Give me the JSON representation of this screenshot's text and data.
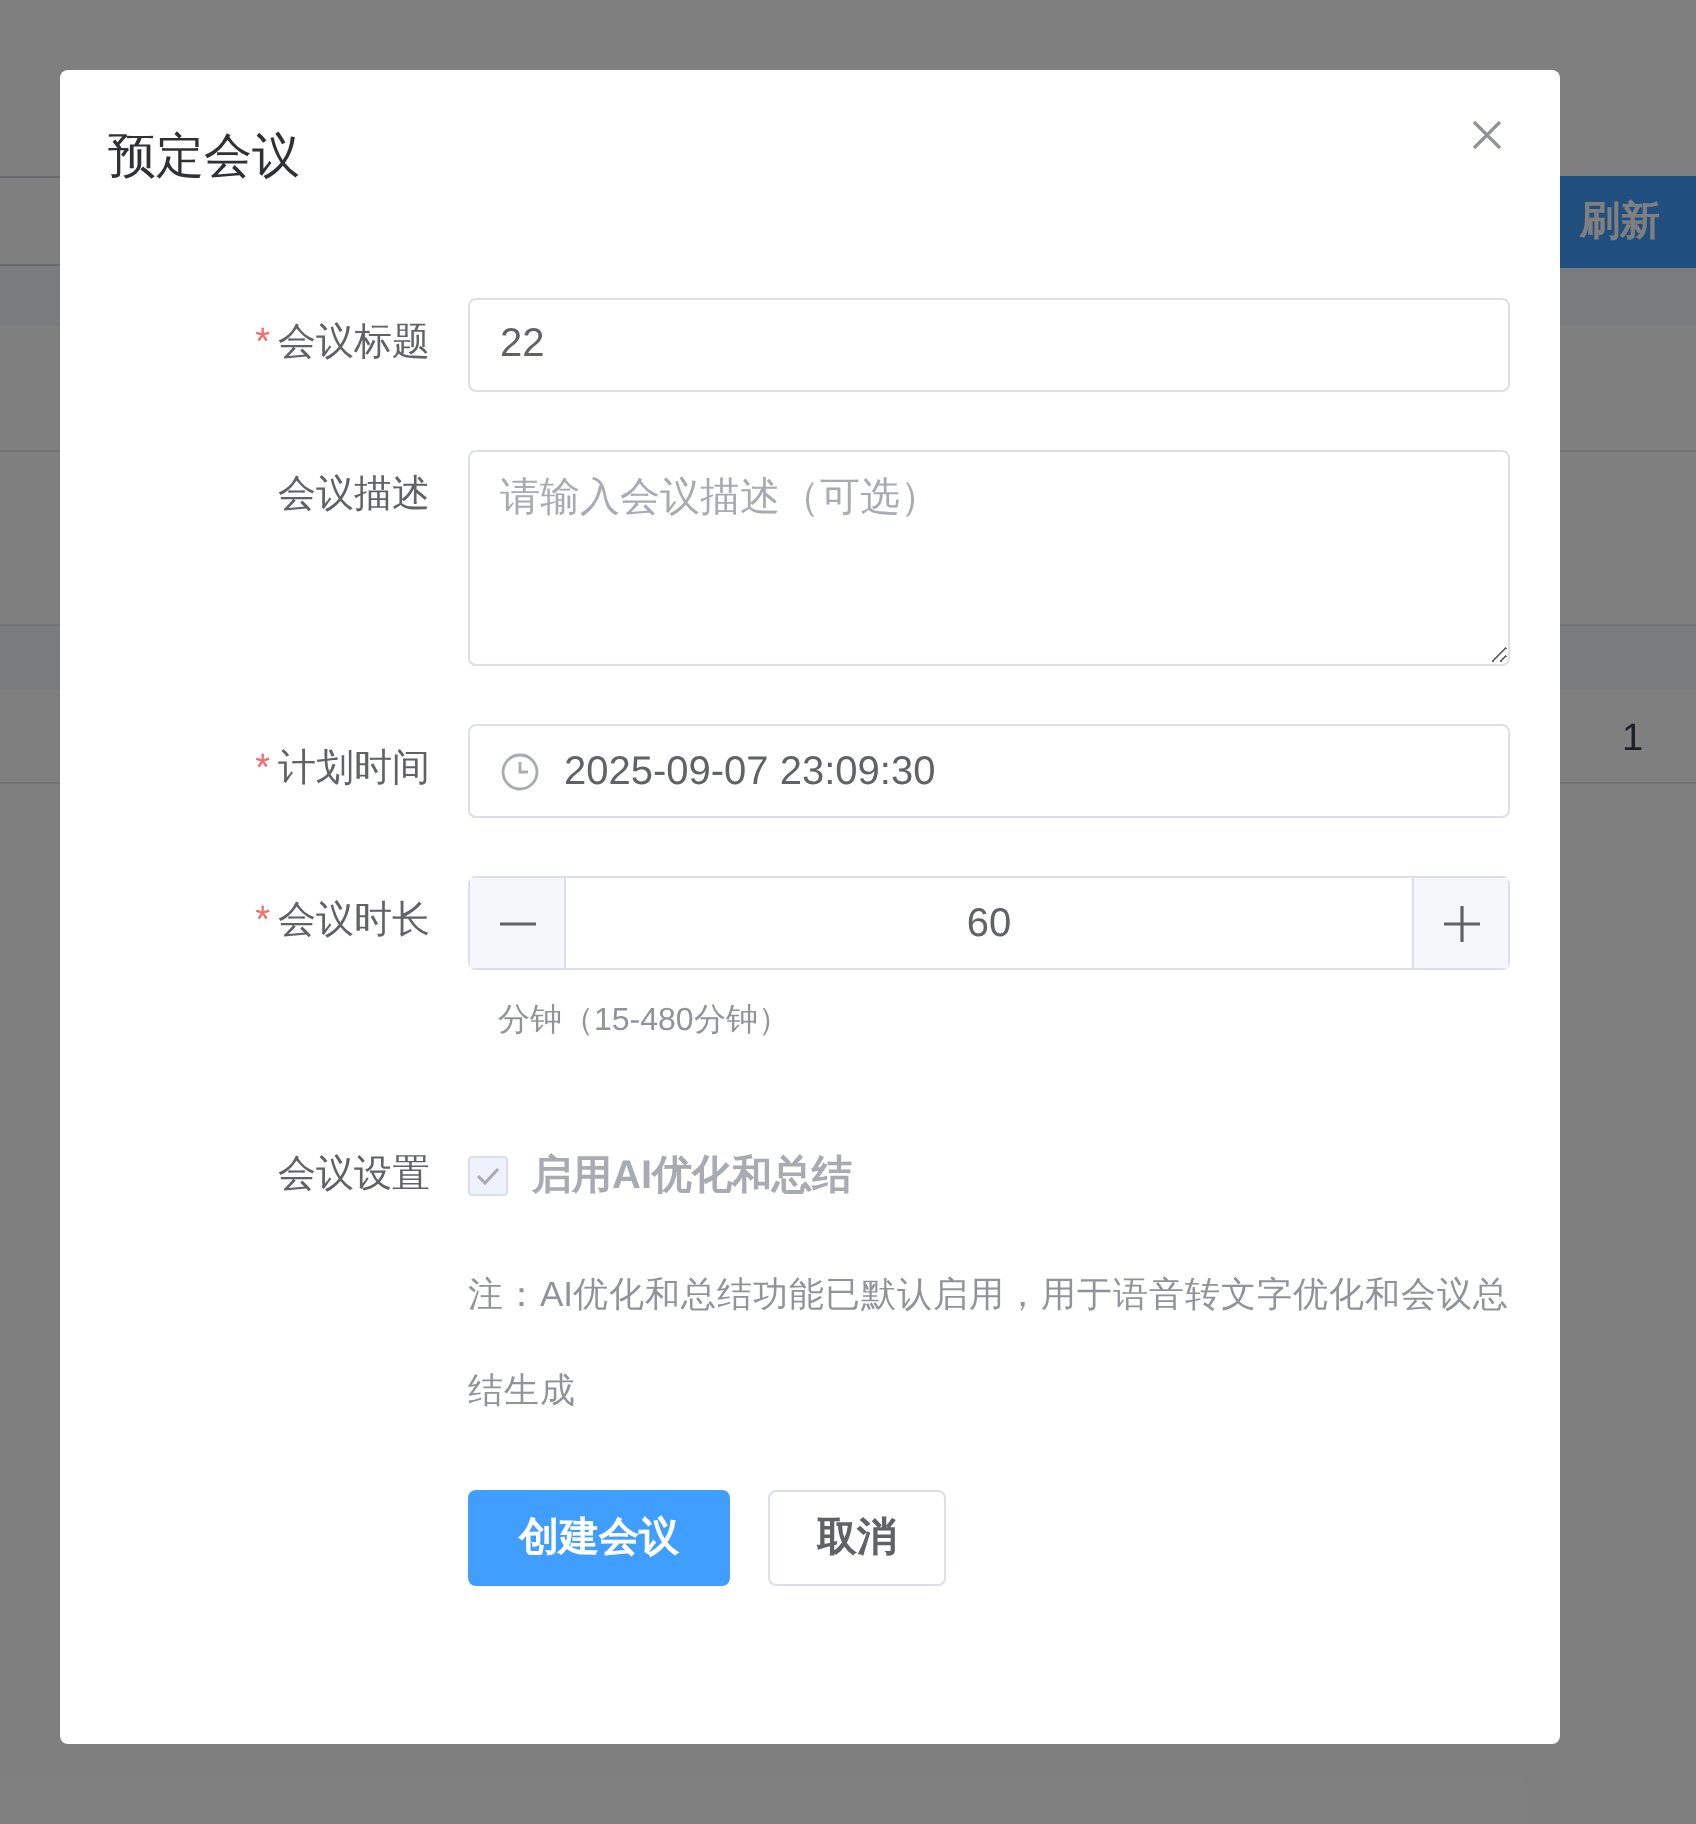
{
  "background": {
    "refresh_button": "刷新",
    "table_cell": "1"
  },
  "dialog": {
    "title": "预定会议"
  },
  "fields": [
    {
      "kind": "text",
      "marker": "*",
      "label": "会议标题",
      "value": "22"
    },
    {
      "kind": "textarea",
      "label": "会议描述",
      "placeholder": "请输入会议描述（可选）"
    },
    {
      "kind": "datetime",
      "marker": "*",
      "label": "计划时间",
      "value": "2025-09-07 23:09:30"
    },
    {
      "kind": "number",
      "marker": "*",
      "label": "会议时长",
      "value": "60",
      "hint": "分钟（15-480分钟）"
    },
    {
      "kind": "checkbox",
      "label": "会议设置",
      "option": "启用AI优化和总结",
      "checked": true,
      "disabled": true,
      "note": "注：AI优化和总结功能已默认启用，用于语音转文字优化和会议总结生成"
    }
  ],
  "buttons": [
    {
      "label": "创建会议",
      "kind": "primary"
    },
    {
      "label": "取消",
      "kind": "default"
    }
  ]
}
